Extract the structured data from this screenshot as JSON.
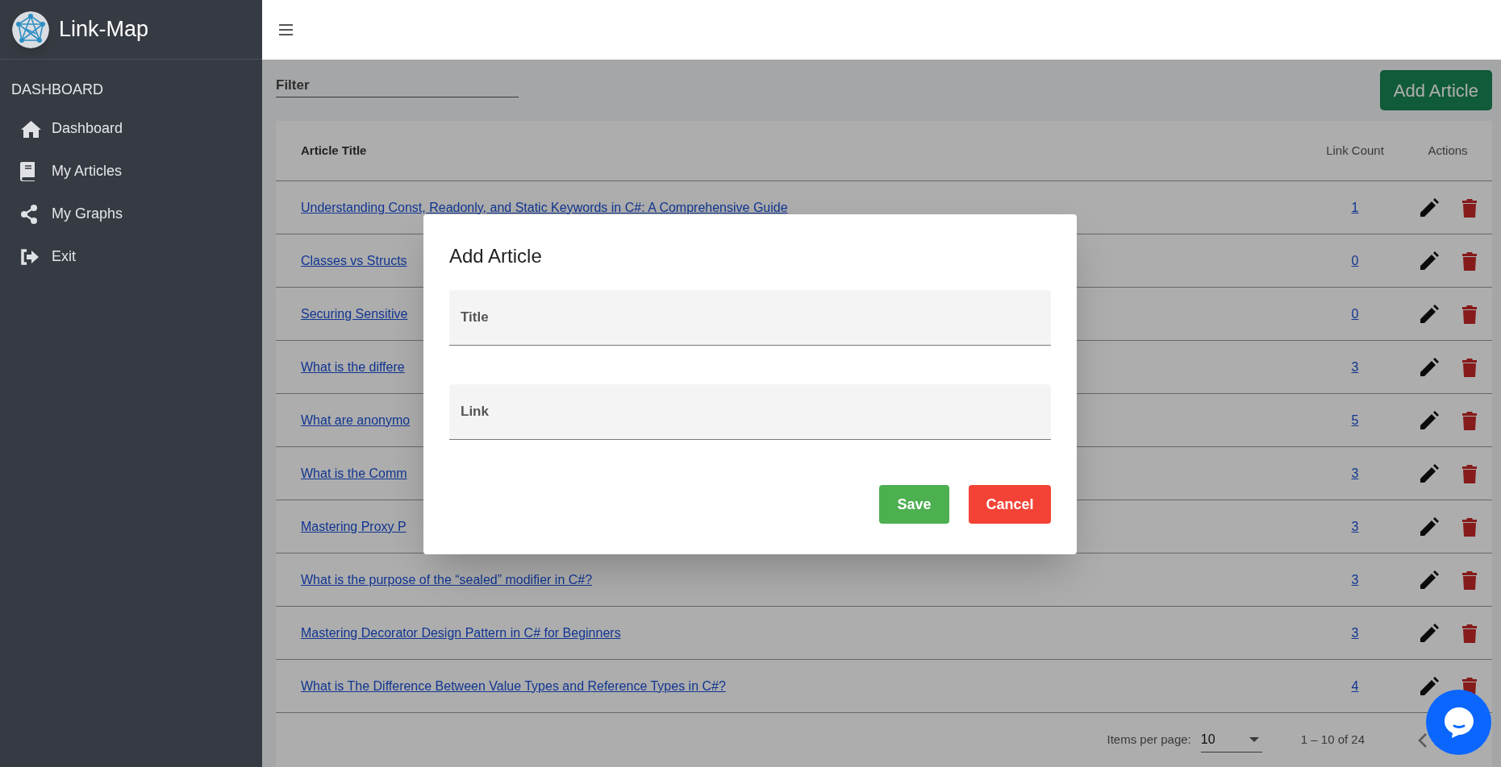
{
  "sidebar": {
    "brand": "Link-Map",
    "section": "DASHBOARD",
    "items": [
      {
        "label": "Dashboard"
      },
      {
        "label": "My Articles"
      },
      {
        "label": "My Graphs"
      },
      {
        "label": "Exit"
      }
    ]
  },
  "filter": {
    "placeholder": "Filter"
  },
  "add_button": "Add Article",
  "table": {
    "columns": [
      "Article Title",
      "Link Count",
      "Actions"
    ],
    "rows": [
      {
        "title": "Understanding Const, Readonly, and Static Keywords in C#: A Comprehensive Guide",
        "link_count": "1"
      },
      {
        "title": "Classes vs Structs",
        "link_count": "0"
      },
      {
        "title": "Securing Sensitive",
        "link_count": "0"
      },
      {
        "title": "What is the differe",
        "link_count": "3"
      },
      {
        "title": "What are anonymo",
        "link_count": "5"
      },
      {
        "title": "What is the Comm",
        "link_count": "3"
      },
      {
        "title": "Mastering Proxy P",
        "link_count": "3"
      },
      {
        "title": "What is the purpose of the “sealed” modifier in C#?",
        "link_count": "3"
      },
      {
        "title": "Mastering Decorator Design Pattern in C# for Beginners",
        "link_count": "3"
      },
      {
        "title": "What is The Difference Between Value Types and Reference Types in C#?",
        "link_count": "4"
      }
    ]
  },
  "paginator": {
    "label": "Items per page:",
    "page_size": "10",
    "range": "1 – 10 of 24"
  },
  "dialog": {
    "title": "Add Article",
    "fields": [
      {
        "placeholder": "Title"
      },
      {
        "placeholder": "Link"
      }
    ],
    "buttons": [
      {
        "label": "Save",
        "kind": "primary"
      },
      {
        "label": "Cancel",
        "kind": "danger"
      }
    ]
  }
}
